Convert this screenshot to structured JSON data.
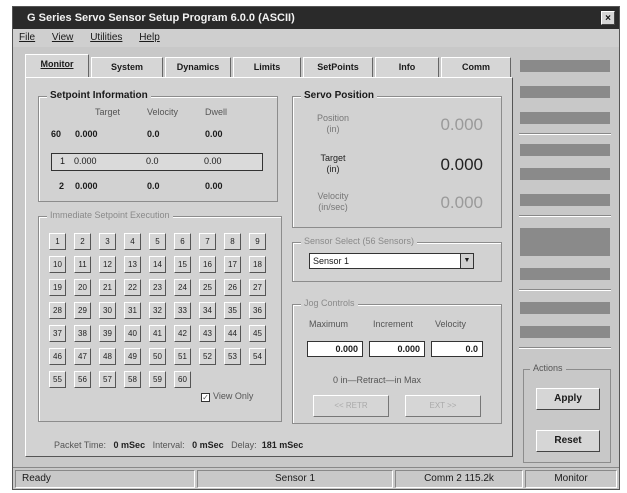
{
  "window": {
    "title": "G Series Servo Sensor Setup Program 6.0.0 (ASCII)",
    "close_glyph": "×"
  },
  "menu": [
    "File",
    "View",
    "Utilities",
    "Help"
  ],
  "tabs": [
    "Monitor",
    "System",
    "Dynamics",
    "Limits",
    "SetPoints",
    "Info",
    "Comm"
  ],
  "setpoint_info": {
    "title": "Setpoint Information",
    "headers": [
      "Target",
      "Velocity",
      "Dwell"
    ],
    "rows": [
      {
        "index": "60",
        "target": "0.000",
        "velocity": "0.0",
        "dwell": "0.00"
      },
      {
        "index": "1",
        "target": "0.000",
        "velocity": "0.0",
        "dwell": "0.00"
      },
      {
        "index": "2",
        "target": "0.000",
        "velocity": "0.0",
        "dwell": "0.00"
      }
    ]
  },
  "servo_position": {
    "title": "Servo Position",
    "position_label": "Position",
    "position_unit": "(in)",
    "position_value": "0.000",
    "target_label": "Target",
    "target_unit": "(in)",
    "target_value": "0.000",
    "velocity_label": "Velocity",
    "velocity_unit": "(in/sec)",
    "velocity_value": "0.000"
  },
  "sensor_select": {
    "title": "Sensor Select (56 Sensors)",
    "value": "Sensor 1",
    "arrow": "▼"
  },
  "immediate_setpoint": {
    "title": "Immediate Setpoint Execution",
    "buttons": [
      "1",
      "2",
      "3",
      "4",
      "5",
      "6",
      "7",
      "8",
      "9",
      "10",
      "11",
      "12",
      "13",
      "14",
      "15",
      "16",
      "17",
      "18",
      "19",
      "20",
      "21",
      "22",
      "23",
      "24",
      "25",
      "26",
      "27",
      "28",
      "29",
      "30",
      "31",
      "32",
      "33",
      "34",
      "35",
      "36",
      "37",
      "38",
      "39",
      "40",
      "41",
      "42",
      "43",
      "44",
      "45",
      "46",
      "47",
      "48",
      "49",
      "50",
      "51",
      "52",
      "53",
      "54",
      "55",
      "56",
      "57",
      "58",
      "59",
      "60"
    ],
    "view_only_label": "View Only",
    "view_only_checked": true,
    "check_glyph": "✓"
  },
  "jog_controls": {
    "title": "Jog Controls",
    "headers": [
      "Maximum",
      "Increment",
      "Velocity"
    ],
    "values": [
      "0.000",
      "0.000",
      "0.0"
    ],
    "caption": "0 in—Retract—in Max",
    "retract_button": "<< RETR",
    "extend_button": "EXT >>"
  },
  "packet_info": {
    "packet_time_label": "Packet Time:",
    "packet_time_value": "0 mSec",
    "interval_label": "Interval:",
    "interval_value": "0 mSec",
    "delay_label": "Delay:",
    "delay_value": "181 mSec"
  },
  "actions": {
    "title": "Actions",
    "apply": "Apply",
    "reset": "Reset"
  },
  "status": {
    "ready": "Ready",
    "sensor": "Sensor 1",
    "comm": "Comm 2 115.2k",
    "mode": "Monitor"
  }
}
